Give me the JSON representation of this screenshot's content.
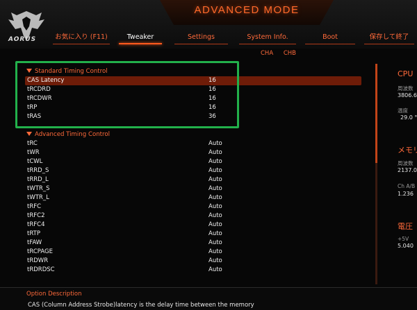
{
  "header": {
    "logo_text": "AORUS",
    "mode_title": "ADVANCED MODE"
  },
  "tabs": [
    {
      "label": "お気に入り (F11)",
      "active": false
    },
    {
      "label": "Tweaker",
      "active": true
    },
    {
      "label": "Settings",
      "active": false
    },
    {
      "label": "System Info.",
      "active": false
    },
    {
      "label": "Boot",
      "active": false
    },
    {
      "label": "保存して終了",
      "active": false
    }
  ],
  "channels": {
    "a": "CHA",
    "b": "CHB"
  },
  "standard_section": {
    "title": "Standard Timing Control",
    "rows": [
      {
        "label": "CAS Latency",
        "value": "16",
        "selected": true
      },
      {
        "label": "tRCDRD",
        "value": "16"
      },
      {
        "label": "tRCDWR",
        "value": "16"
      },
      {
        "label": "tRP",
        "value": "16"
      },
      {
        "label": "tRAS",
        "value": "36"
      }
    ]
  },
  "advanced_section": {
    "title": "Advanced Timing Control",
    "rows": [
      {
        "label": "tRC",
        "value": "Auto"
      },
      {
        "label": "tWR",
        "value": "Auto"
      },
      {
        "label": "tCWL",
        "value": "Auto"
      },
      {
        "label": "tRRD_S",
        "value": "Auto"
      },
      {
        "label": "tRRD_L",
        "value": "Auto"
      },
      {
        "label": "tWTR_S",
        "value": "Auto"
      },
      {
        "label": "tWTR_L",
        "value": "Auto"
      },
      {
        "label": "tRFC",
        "value": "Auto"
      },
      {
        "label": "tRFC2",
        "value": "Auto"
      },
      {
        "label": "tRFC4",
        "value": "Auto"
      },
      {
        "label": "tRTP",
        "value": "Auto"
      },
      {
        "label": "tFAW",
        "value": "Auto"
      },
      {
        "label": "tRCPAGE",
        "value": "Auto"
      },
      {
        "label": "tRDWR",
        "value": "Auto"
      },
      {
        "label": "tRDRDSC",
        "value": "Auto"
      }
    ]
  },
  "scrollbar": {
    "thumb_fraction": 0.45
  },
  "right_panel": {
    "cpu_title": "CPU",
    "cpu_freq_label": "周波数",
    "cpu_freq_value": "3806.6",
    "cpu_temp_label": "温度",
    "cpu_temp_value": "29.0 °",
    "memory_title": "メモリ",
    "mem_freq_label": "周波数",
    "mem_freq_value": "2137.0",
    "mem_ch_label": "Ch A/B",
    "mem_ch_value": "1.236",
    "voltage_title": "電圧",
    "v5_label": "+5V",
    "v5_value": "5.040"
  },
  "description": {
    "title": "Option Description",
    "text": "CAS (Column Address Strobe)latency is the delay time between the memory"
  },
  "colors": {
    "accent": "#ff6a3a",
    "selected_row": "#6e1c08",
    "highlight_box": "#22b04b"
  }
}
